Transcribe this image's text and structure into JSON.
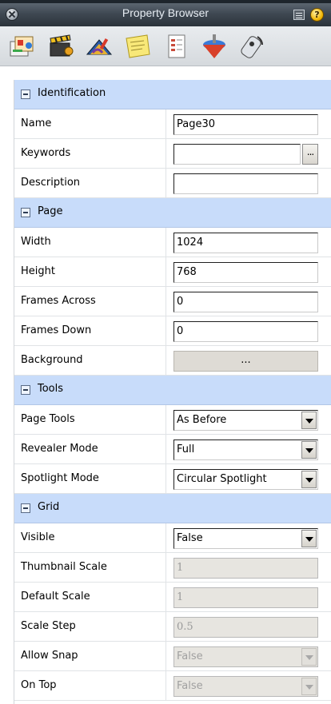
{
  "window": {
    "title": "Property Browser"
  },
  "toolbar": {
    "tools": [
      {
        "icon": "insert-object-icon"
      },
      {
        "icon": "media-clapper-icon"
      },
      {
        "icon": "book-tools-icon"
      },
      {
        "icon": "sticky-note-icon"
      },
      {
        "icon": "page-properties-icon"
      },
      {
        "icon": "spinning-top-icon"
      },
      {
        "icon": "remote-control-icon"
      }
    ]
  },
  "sections": {
    "identification": {
      "label": "Identification",
      "name": {
        "label": "Name",
        "value": "Page30"
      },
      "keywords": {
        "label": "Keywords",
        "value": "",
        "button": "..."
      },
      "description": {
        "label": "Description",
        "value": ""
      }
    },
    "page": {
      "label": "Page",
      "width": {
        "label": "Width",
        "value": "1024"
      },
      "height": {
        "label": "Height",
        "value": "768"
      },
      "frames_across": {
        "label": "Frames Across",
        "value": "0"
      },
      "frames_down": {
        "label": "Frames Down",
        "value": "0"
      },
      "background": {
        "label": "Background",
        "button": "..."
      }
    },
    "tools": {
      "label": "Tools",
      "page_tools": {
        "label": "Page Tools",
        "value": "As Before"
      },
      "revealer_mode": {
        "label": "Revealer Mode",
        "value": "Full"
      },
      "spotlight_mode": {
        "label": "Spotlight Mode",
        "value": "Circular Spotlight"
      }
    },
    "grid": {
      "label": "Grid",
      "visible": {
        "label": "Visible",
        "value": "False"
      },
      "thumbnail_scale": {
        "label": "Thumbnail Scale",
        "value": "1"
      },
      "default_scale": {
        "label": "Default Scale",
        "value": "1"
      },
      "scale_step": {
        "label": "Scale Step",
        "value": "0.5"
      },
      "allow_snap": {
        "label": "Allow Snap",
        "value": "False"
      },
      "on_top": {
        "label": "On Top",
        "value": "False"
      }
    }
  }
}
